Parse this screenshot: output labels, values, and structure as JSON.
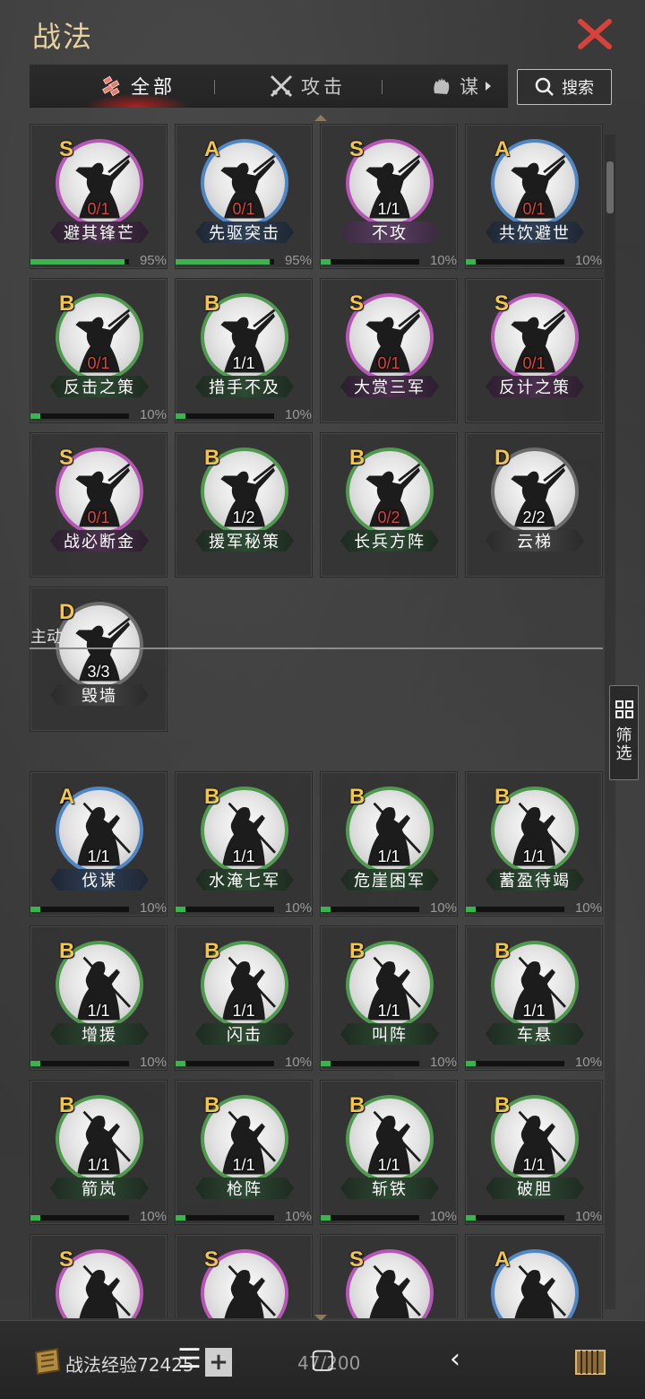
{
  "header": {
    "title": "战法"
  },
  "tabs": [
    {
      "label": "全部",
      "active": true
    },
    {
      "label": "攻击",
      "active": false
    },
    {
      "label": "谋",
      "active": false
    }
  ],
  "search": {
    "label": "搜索"
  },
  "filter": {
    "label1": "筛",
    "label2": "选"
  },
  "section": {
    "active_label": "主动"
  },
  "colors": {
    "accent": "#e0433a",
    "grade_S": "#b856b8",
    "grade_A": "#4f86c6",
    "grade_B": "#4f9a4f",
    "grade_D": "#6c6c6c",
    "progress": "#3bb34f",
    "grade_text": "#f2c64a"
  },
  "cards_top": [
    {
      "grade": "S",
      "count": "0/1",
      "name": "避其锋芒",
      "progress": 95,
      "pct": "95%"
    },
    {
      "grade": "A",
      "count": "0/1",
      "name": "先驱突击",
      "progress": 95,
      "pct": "95%"
    },
    {
      "grade": "S",
      "count": "1/1",
      "name": "不攻",
      "progress": 10,
      "pct": "10%"
    },
    {
      "grade": "A",
      "count": "0/1",
      "name": "共饮避世",
      "progress": 10,
      "pct": "10%"
    },
    {
      "grade": "B",
      "count": "0/1",
      "name": "反击之策",
      "progress": 10,
      "pct": "10%"
    },
    {
      "grade": "B",
      "count": "1/1",
      "name": "措手不及",
      "progress": 10,
      "pct": "10%"
    },
    {
      "grade": "S",
      "count": "0/1",
      "name": "大赏三军",
      "progress": null,
      "pct": ""
    },
    {
      "grade": "S",
      "count": "0/1",
      "name": "反计之策",
      "progress": null,
      "pct": ""
    },
    {
      "grade": "S",
      "count": "0/1",
      "name": "战必断金",
      "progress": null,
      "pct": ""
    },
    {
      "grade": "B",
      "count": "1/2",
      "name": "援军秘策",
      "progress": null,
      "pct": ""
    },
    {
      "grade": "B",
      "count": "0/2",
      "name": "长兵方阵",
      "progress": null,
      "pct": ""
    },
    {
      "grade": "D",
      "count": "2/2",
      "name": "云梯",
      "progress": null,
      "pct": ""
    },
    {
      "grade": "D",
      "count": "3/3",
      "name": "毁墙",
      "progress": null,
      "pct": ""
    }
  ],
  "cards_active": [
    {
      "grade": "A",
      "count": "1/1",
      "name": "伐谋",
      "progress": 10,
      "pct": "10%"
    },
    {
      "grade": "B",
      "count": "1/1",
      "name": "水淹七军",
      "progress": 10,
      "pct": "10%"
    },
    {
      "grade": "B",
      "count": "1/1",
      "name": "危崖困军",
      "progress": 10,
      "pct": "10%"
    },
    {
      "grade": "B",
      "count": "1/1",
      "name": "蓄盈待竭",
      "progress": 10,
      "pct": "10%"
    },
    {
      "grade": "B",
      "count": "1/1",
      "name": "增援",
      "progress": 10,
      "pct": "10%"
    },
    {
      "grade": "B",
      "count": "1/1",
      "name": "闪击",
      "progress": 10,
      "pct": "10%"
    },
    {
      "grade": "B",
      "count": "1/1",
      "name": "叫阵",
      "progress": 10,
      "pct": "10%"
    },
    {
      "grade": "B",
      "count": "1/1",
      "name": "车悬",
      "progress": 10,
      "pct": "10%"
    },
    {
      "grade": "B",
      "count": "1/1",
      "name": "箭岚",
      "progress": 10,
      "pct": "10%"
    },
    {
      "grade": "B",
      "count": "1/1",
      "name": "枪阵",
      "progress": 10,
      "pct": "10%"
    },
    {
      "grade": "B",
      "count": "1/1",
      "name": "斩铁",
      "progress": 10,
      "pct": "10%"
    },
    {
      "grade": "B",
      "count": "1/1",
      "name": "破胆",
      "progress": 10,
      "pct": "10%"
    },
    {
      "grade": "S",
      "count": "",
      "name": "",
      "progress": null,
      "pct": ""
    },
    {
      "grade": "S",
      "count": "",
      "name": "",
      "progress": null,
      "pct": ""
    },
    {
      "grade": "S",
      "count": "",
      "name": "",
      "progress": null,
      "pct": ""
    },
    {
      "grade": "A",
      "count": "",
      "name": "",
      "progress": null,
      "pct": ""
    }
  ],
  "bottom": {
    "exp_label": "战法经验72425",
    "capacity": "47/200"
  }
}
